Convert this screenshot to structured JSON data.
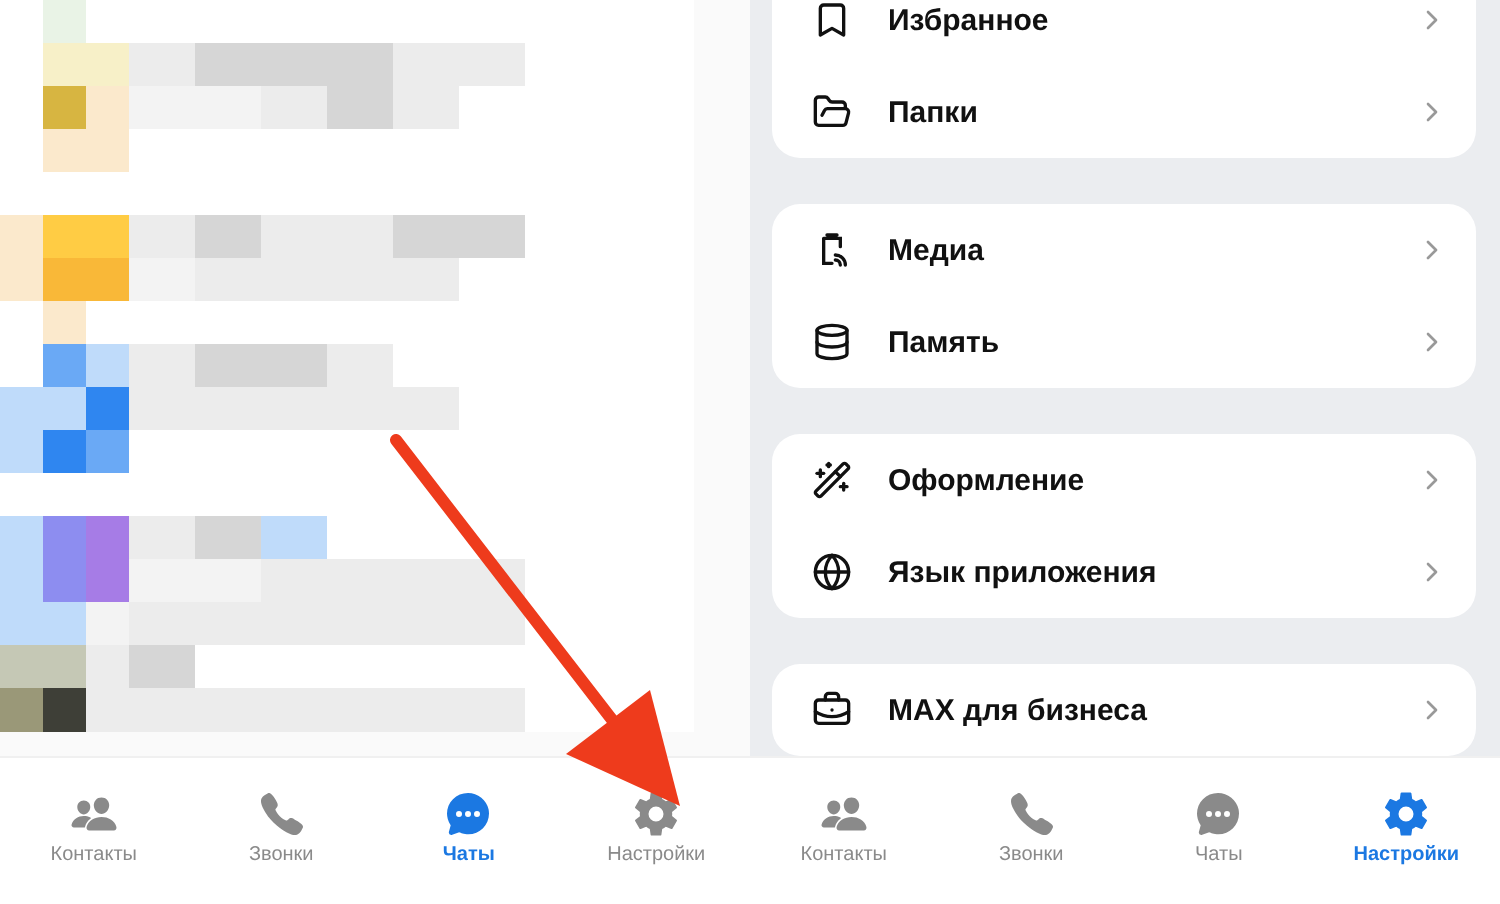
{
  "left_screen": {
    "tab_bar": [
      {
        "label": "Контакты",
        "selected": false
      },
      {
        "label": "Звонки",
        "selected": false
      },
      {
        "label": "Чаты",
        "selected": true
      },
      {
        "label": "Настройки",
        "selected": false
      }
    ]
  },
  "right_screen": {
    "settings_groups": [
      {
        "items": [
          {
            "label": "Избранное"
          },
          {
            "label": "Папки"
          }
        ]
      },
      {
        "items": [
          {
            "label": "Медиа"
          },
          {
            "label": "Память"
          }
        ]
      },
      {
        "items": [
          {
            "label": "Оформление"
          },
          {
            "label": "Язык приложения"
          }
        ]
      },
      {
        "items": [
          {
            "label": "MAX для бизнеса"
          }
        ]
      }
    ],
    "tab_bar": [
      {
        "label": "Контакты",
        "selected": false
      },
      {
        "label": "Звонки",
        "selected": false
      },
      {
        "label": "Чаты",
        "selected": false
      },
      {
        "label": "Настройки",
        "selected": true
      }
    ]
  }
}
